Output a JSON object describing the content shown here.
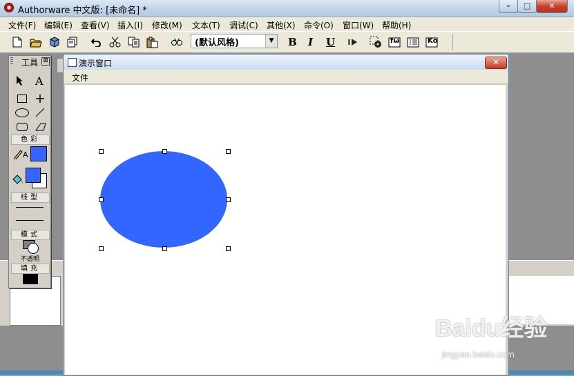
{
  "window": {
    "title": "Authorware 中文版: [未命名] *",
    "min_glyph": "–",
    "max_glyph": "□",
    "close_glyph": "✕"
  },
  "menubar": {
    "items": [
      "文件(F)",
      "编辑(E)",
      "查看(V)",
      "插入(I)",
      "修改(M)",
      "文本(T)",
      "调试(C)",
      "其他(X)",
      "命令(O)",
      "窗口(W)",
      "帮助(H)"
    ]
  },
  "toolbar": {
    "style_value": "(默认风格)",
    "bold_label": "B",
    "italic_label": "I",
    "underline_label": "U",
    "fx_label": "fω",
    "ko_label": "Ko"
  },
  "palette": {
    "title": "工具",
    "close_glyph": "⊠",
    "section_color": "色彩",
    "section_line": "线型",
    "section_mode": "模式",
    "mode_value": "不透明",
    "section_fill": "填充",
    "text_tool_label": "A",
    "pen_color_label": "A"
  },
  "presentation": {
    "title": "演示窗口",
    "menu_file": "文件",
    "close_glyph": "✕"
  },
  "colors": {
    "ellipse_fill": "#3366ff",
    "fill_swatch": "#000000"
  },
  "watermark": {
    "brand": "Baidu经验",
    "url": "jingyan.baidu.com"
  }
}
